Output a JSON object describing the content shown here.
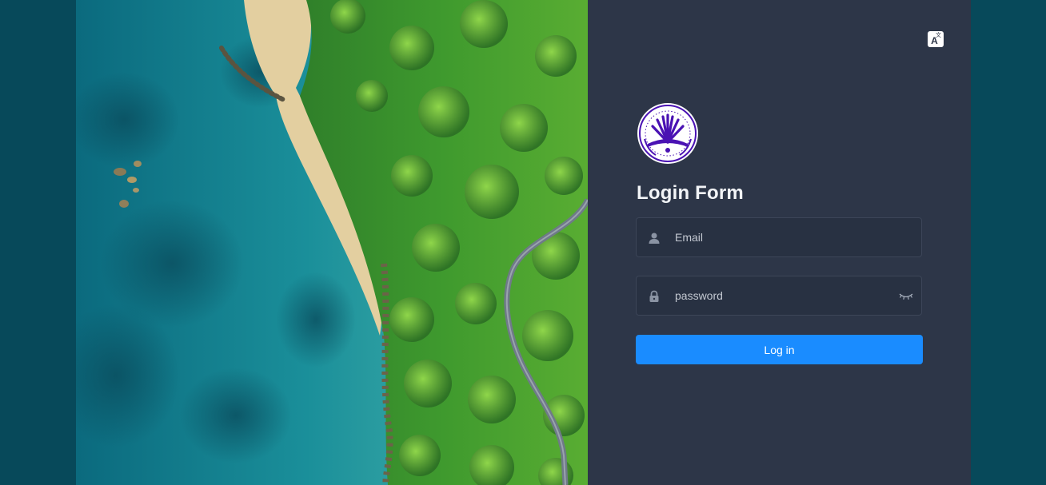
{
  "login_form": {
    "title": "Login Form",
    "email_placeholder": "Email",
    "email_value": "",
    "password_placeholder": "password",
    "password_value": "",
    "submit_label": "Log in"
  },
  "language_switch": {
    "icon": "translate-icon"
  },
  "icons": {
    "email": "user-icon",
    "password": "lock-icon",
    "visibility": "eye-closed-icon"
  },
  "colors": {
    "page_background": "#07495a",
    "panel_background": "#2d3648",
    "input_background": "#283142",
    "accent": "#1a8cff",
    "logo_primary": "#4a12b3"
  }
}
